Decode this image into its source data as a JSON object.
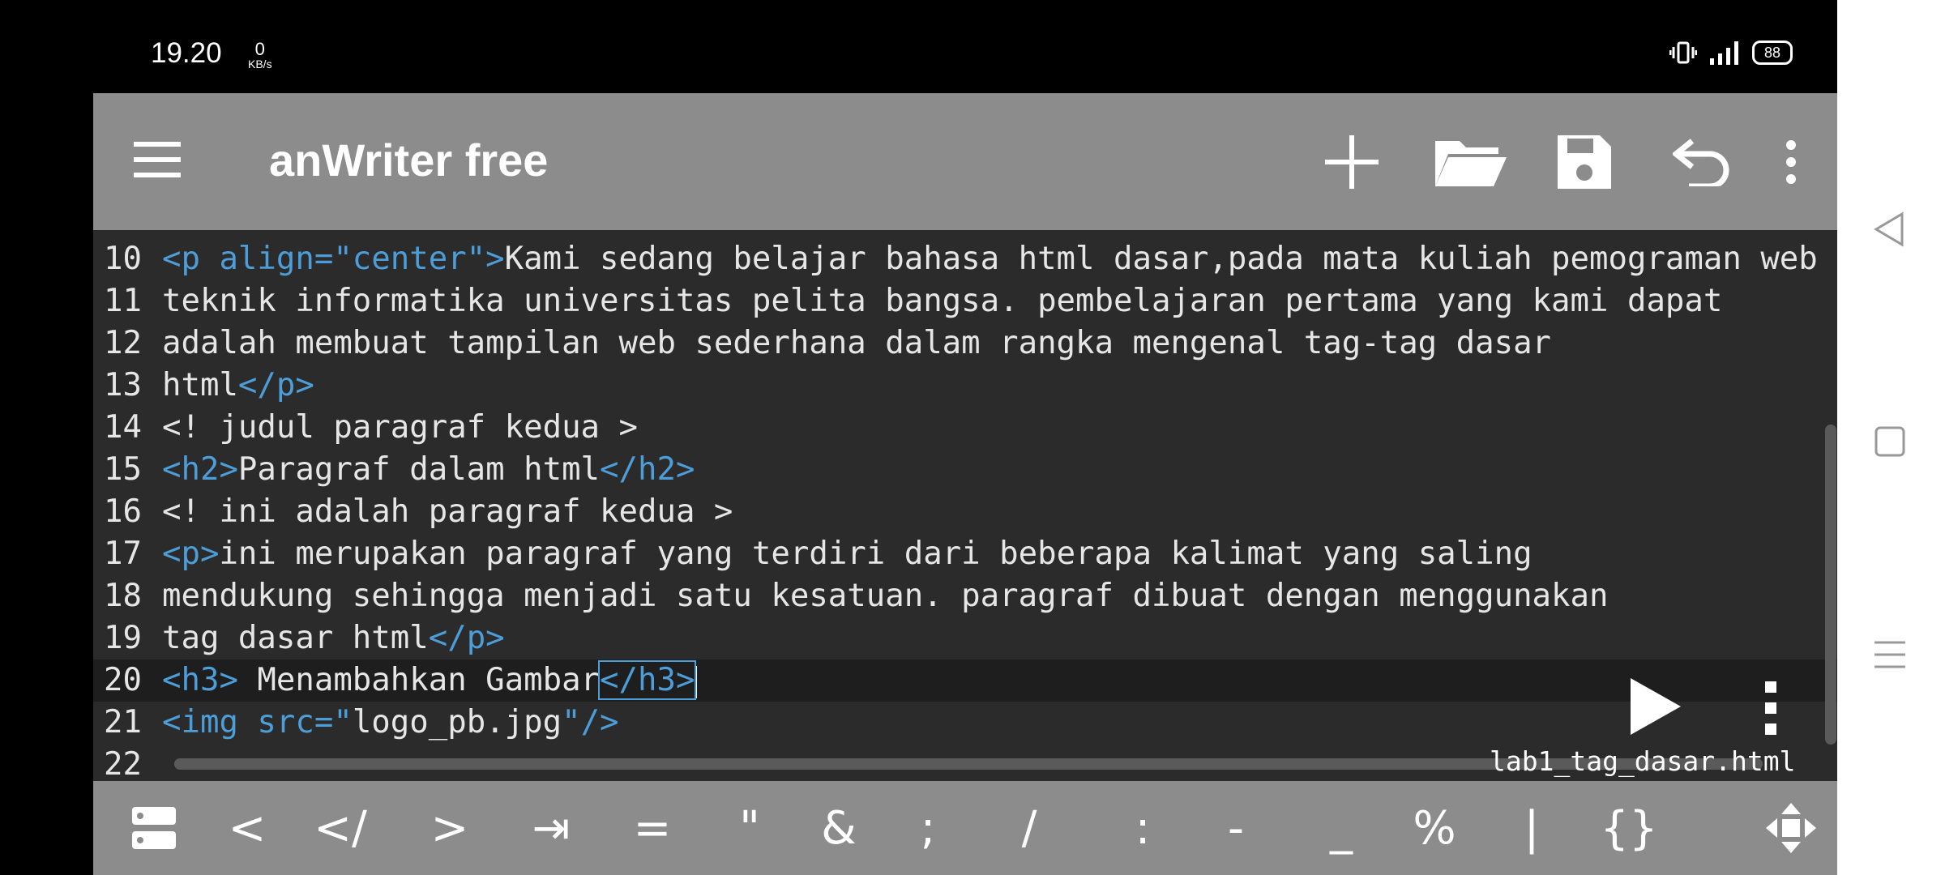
{
  "status": {
    "time": "19.20",
    "netspeed_value": "0",
    "netspeed_unit": "KB/s",
    "battery": "88"
  },
  "app": {
    "title": "anWriter free"
  },
  "editor": {
    "lines": [
      {
        "no": "10",
        "segs": [
          {
            "t": "<p align=\"center\">",
            "c": "tag"
          },
          {
            "t": "Kami sedang belajar bahasa html dasar,pada mata kuliah pemograman web di",
            "c": "text"
          }
        ]
      },
      {
        "no": "11",
        "segs": [
          {
            "t": "teknik informatika universitas pelita bangsa. pembelajaran pertama yang kami dapat",
            "c": "text"
          }
        ]
      },
      {
        "no": "12",
        "segs": [
          {
            "t": "adalah membuat tampilan web sederhana dalam rangka mengenal tag-tag dasar",
            "c": "text"
          }
        ]
      },
      {
        "no": "13",
        "segs": [
          {
            "t": "html",
            "c": "text"
          },
          {
            "t": "</p>",
            "c": "tag"
          }
        ]
      },
      {
        "no": "14",
        "segs": [
          {
            "t": "<! judul paragraf kedua >",
            "c": "text"
          }
        ]
      },
      {
        "no": "15",
        "segs": [
          {
            "t": "<h2>",
            "c": "tag"
          },
          {
            "t": "Paragraf dalam html",
            "c": "text"
          },
          {
            "t": "</h2>",
            "c": "tag"
          }
        ]
      },
      {
        "no": "16",
        "segs": [
          {
            "t": "<! ini adalah paragraf kedua >",
            "c": "text"
          }
        ]
      },
      {
        "no": "17",
        "segs": [
          {
            "t": "<p>",
            "c": "tag"
          },
          {
            "t": "ini merupakan paragraf yang terdiri dari beberapa kalimat yang saling",
            "c": "text"
          }
        ]
      },
      {
        "no": "18",
        "segs": [
          {
            "t": "mendukung sehingga menjadi satu kesatuan. paragraf dibuat dengan menggunakan",
            "c": "text"
          }
        ]
      },
      {
        "no": "19",
        "segs": [
          {
            "t": "tag dasar html",
            "c": "text"
          },
          {
            "t": "</p>",
            "c": "tag"
          }
        ]
      },
      {
        "no": "20",
        "segs": [
          {
            "t": "<h3>",
            "c": "tag"
          },
          {
            "t": " Menambahkan Gambar",
            "c": "text"
          },
          {
            "t": "</h3>",
            "c": "tag-box"
          }
        ],
        "current": true
      },
      {
        "no": "21",
        "segs": [
          {
            "t": "<img src=\"",
            "c": "tag"
          },
          {
            "t": "logo_pb.jpg",
            "c": "text"
          },
          {
            "t": "\"/>",
            "c": "tag"
          }
        ]
      },
      {
        "no": "22",
        "segs": []
      }
    ],
    "filename": "lab1_tag_dasar.html"
  },
  "keys": [
    "<",
    "</",
    ">",
    "⇥",
    "=",
    "\"",
    "&",
    ";",
    "/",
    ":",
    "-",
    "_",
    "%",
    "|",
    "{}"
  ],
  "colors": {
    "appbar": "#8c8c8c",
    "editor_bg": "#2b2b2b",
    "tag": "#4c9dd8",
    "text": "#e6e6e6"
  }
}
